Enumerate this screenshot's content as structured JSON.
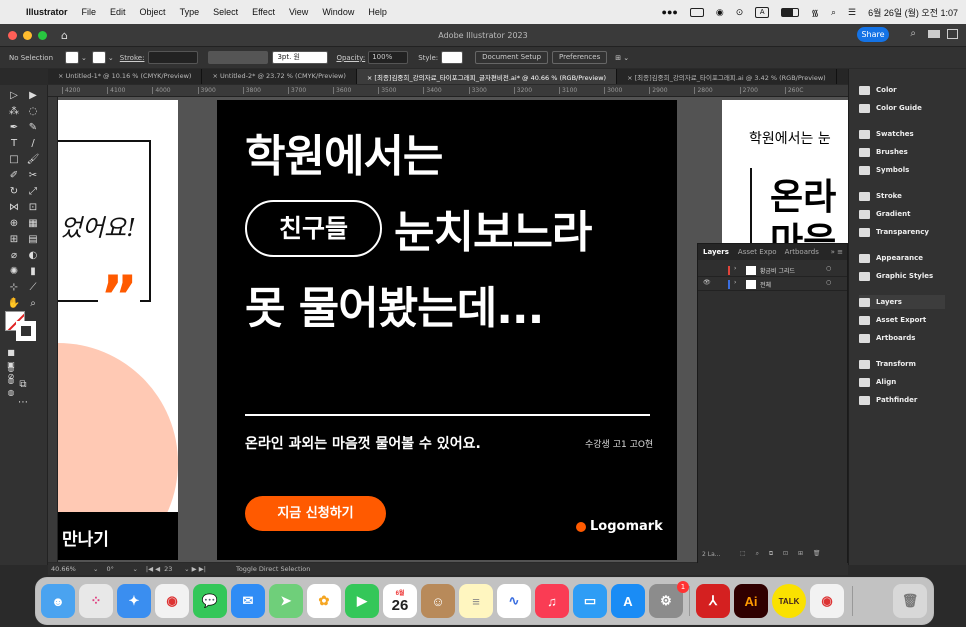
{
  "menubar": {
    "app": "Illustrator",
    "items": [
      "File",
      "Edit",
      "Object",
      "Type",
      "Select",
      "Effect",
      "View",
      "Window",
      "Help"
    ],
    "clock": "6월 26일 (월) 오전 1:07",
    "keyboard": "A"
  },
  "window": {
    "title": "Adobe Illustrator 2023",
    "share": "Share"
  },
  "control": {
    "selection": "No Selection",
    "stroke_label": "Stroke:",
    "brush": "3pt. 원",
    "opacity_label": "Opacity:",
    "opacity_value": "100%",
    "style_label": "Style:",
    "document_setup": "Document Setup",
    "preferences": "Preferences"
  },
  "tabs": [
    "Untitled-1* @ 10.16 % (CMYK/Preview)",
    "Untitled-2* @ 23.72 % (CMYK/Preview)",
    "[최종]김중희_강의자료_타이포그래피_글자편비전.ai* @ 40.66 % (RGB/Preview)",
    "[최종]김중희_강의자료_타이포그래피.ai @ 3.42 % (RGB/Preview)"
  ],
  "ruler": [
    "4200",
    "4100",
    "4000",
    "3900",
    "3800",
    "3700",
    "3600",
    "3500",
    "3400",
    "3300",
    "3200",
    "3100",
    "3000",
    "2900",
    "2800",
    "2700",
    "260C"
  ],
  "artboard": {
    "headline1": "학원에서는",
    "pill": "친구들",
    "headline2": "눈치보느라",
    "headline3": "못 물어봤는데...",
    "subtitle": "온라인 과외는 마음껏 물어볼 수 있어요.",
    "credit": "수강생 고1 고O현",
    "cta": "지금 신청하기",
    "logo": "Logomark"
  },
  "left_artboard": {
    "script_text": "었어요!",
    "quote_mark": "”",
    "bottom_text": "만나기"
  },
  "right_artboard": {
    "headline": "학원에서는 눈",
    "big1": "온라",
    "big2": "마음"
  },
  "layers_panel": {
    "tabs": [
      "Layers",
      "Asset Expo",
      "Artboards"
    ],
    "rows": [
      {
        "name": "황금비 그리드",
        "color": "#e0443a"
      },
      {
        "name": "전체",
        "color": "#3a6ee0"
      }
    ],
    "footer": "2 La..."
  },
  "dock_panels": [
    "Color",
    "Color Guide",
    "Swatches",
    "Brushes",
    "Symbols",
    "Stroke",
    "Gradient",
    "Transparency",
    "Appearance",
    "Graphic Styles",
    "Layers",
    "Asset Export",
    "Artboards",
    "Transform",
    "Align",
    "Pathfinder"
  ],
  "status": {
    "zoom": "40.66%",
    "rotation": "0°",
    "artboard_num": "23",
    "tool": "Toggle Direct Selection"
  },
  "dock_apps": [
    "Finder",
    "Launchpad",
    "Safari",
    "Chrome",
    "Messages",
    "Mail",
    "Maps",
    "Photos",
    "FaceTime",
    "Calendar",
    "Contacts",
    "Notes",
    "Freeform",
    "Music",
    "Keynote",
    "App Store",
    "System Settings",
    "Acrobat",
    "Illustrator",
    "KakaoTalk",
    "Chrome",
    "Trash"
  ],
  "calendar": {
    "month": "6월",
    "day": "26"
  },
  "badge": "1",
  "colors": {
    "cta": "#ff5a00",
    "pill_border": "#ffffff",
    "artboard_bg": "#000000",
    "accent_peach": "#ffc9b4"
  }
}
